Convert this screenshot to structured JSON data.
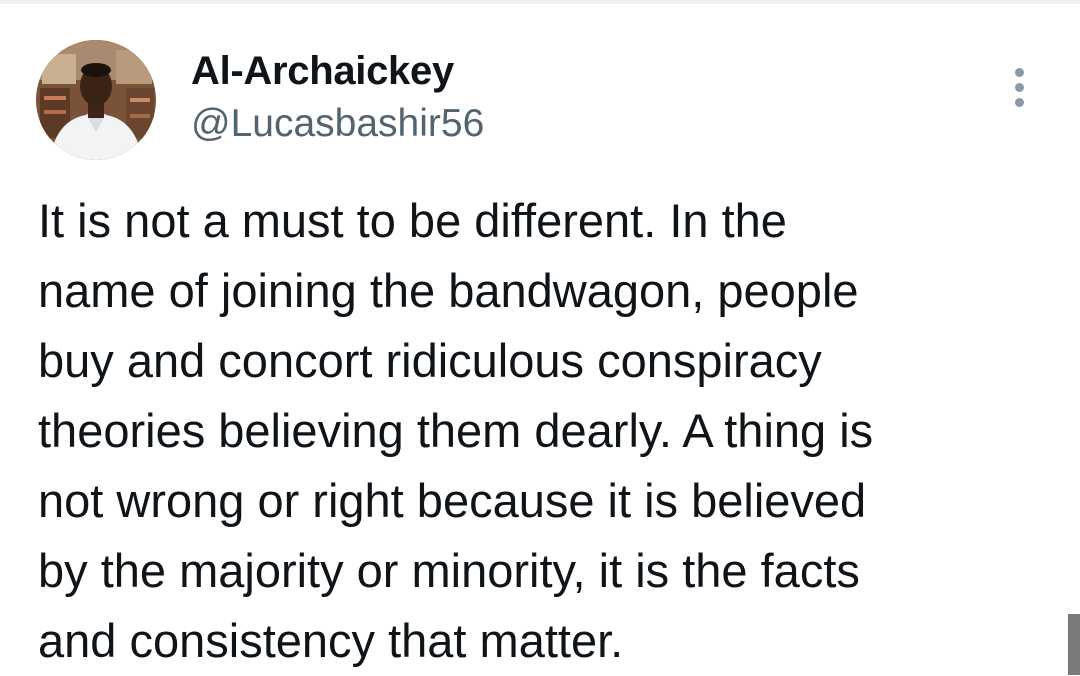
{
  "tweet": {
    "author": {
      "display_name": "Al-Archaickey",
      "handle": "@Lucasbashir56",
      "avatar_icon": "user-avatar-photo"
    },
    "more_icon": "more-options-icon",
    "text_lines": [
      "It is not a must to be different. In the",
      "name of joining the bandwagon, people",
      "buy and concort ridiculous conspiracy",
      "theories believing them dearly. A thing is",
      "not wrong or right because it is believed",
      "by the majority or minority, it is the facts",
      "and consistency that matter."
    ]
  },
  "colors": {
    "text_primary": "#0f1419",
    "text_secondary": "#536471",
    "more_dots": "#8b98a5"
  }
}
